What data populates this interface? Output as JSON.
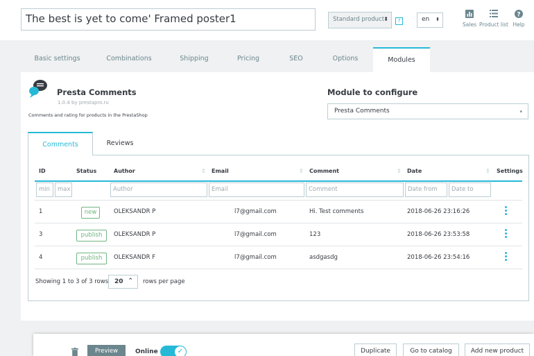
{
  "header": {
    "product_name": "The best is yet to come' Framed poster1",
    "product_type": "Standard product",
    "help_marker": "?",
    "language": "en",
    "links": [
      {
        "label": "Sales",
        "icon": "bar-chart-icon"
      },
      {
        "label": "Product list",
        "icon": "list-icon"
      },
      {
        "label": "Help",
        "icon": "help-icon"
      }
    ]
  },
  "tabs": [
    "Basic settings",
    "Combinations",
    "Shipping",
    "Pricing",
    "SEO",
    "Options",
    "Modules"
  ],
  "active_tab": "Modules",
  "module": {
    "name": "Presta Comments",
    "version": "1.0.4 by prestapro.ru",
    "description": "Comments and rating for products in the PrestaShop",
    "configure_label": "Module to configure",
    "configure_value": "Presta Comments"
  },
  "subtabs": [
    "Comments",
    "Reviews"
  ],
  "table": {
    "columns": [
      "ID",
      "Status",
      "Author",
      "Email",
      "Comment",
      "Date",
      "Settings"
    ],
    "filters": {
      "id_min": "min",
      "id_max": "max",
      "author": "Author",
      "email": "Email",
      "comment": "Comment",
      "date_from": "Date from",
      "date_to": "Date to"
    },
    "rows": [
      {
        "id": "1",
        "status": "new",
        "author": "OLEKSANDR P",
        "email": "l7@gmail.com",
        "comment": "Hi. Test comments",
        "date": "2018-06-26 23:16:26"
      },
      {
        "id": "3",
        "status": "publish",
        "author": "OLEKSANDR P",
        "email": "l7@gmail.com",
        "comment": "123",
        "date": "2018-06-26 23:53:58"
      },
      {
        "id": "4",
        "status": "publish",
        "author": "OLEKSANDR F",
        "email": "l7@gmail.com",
        "comment": "asdgasdg",
        "date": "2018-06-26 23:54:16"
      }
    ],
    "pager_text": "Showing 1 to 3 of 3 rows",
    "per_page": "20",
    "per_page_label": "rows per page"
  },
  "footer": {
    "preview": "Preview",
    "online_label": "Online",
    "online": true,
    "duplicate": "Duplicate",
    "go_to_catalog": "Go to catalog",
    "add_new_product": "Add new product"
  },
  "colors": {
    "accent": "#25b9d7",
    "status_green": "#70b580",
    "preview_button": "#6c868e"
  }
}
